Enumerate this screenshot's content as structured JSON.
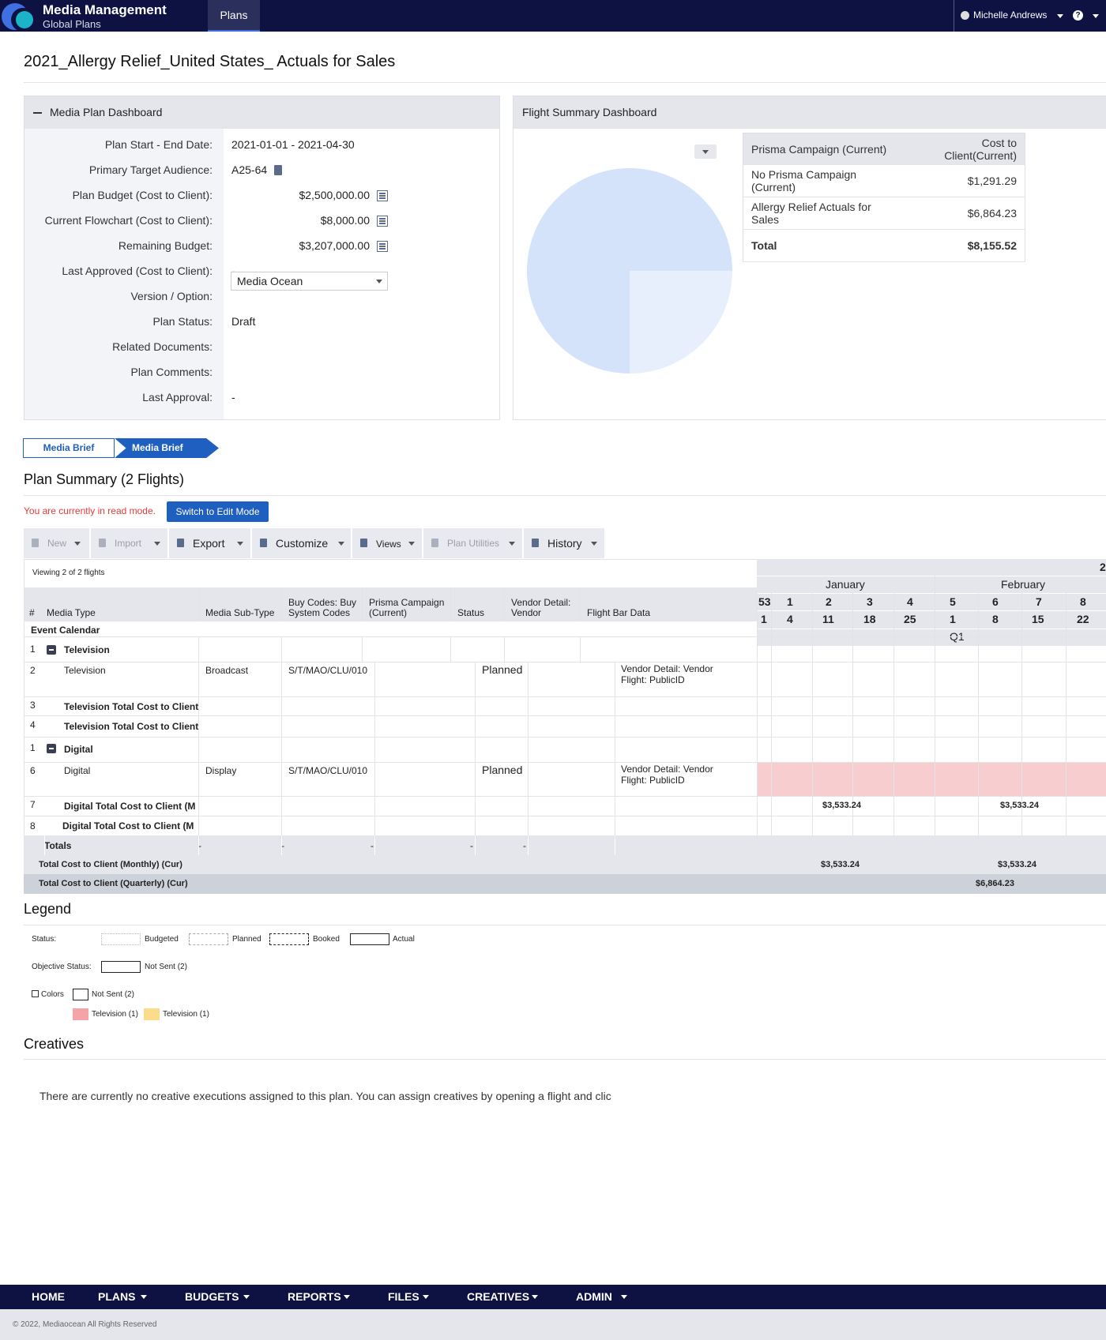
{
  "header": {
    "brand_title": "Media Management",
    "brand_subtitle": "Global Plans",
    "nav_active": "Plans",
    "user_name": "Michelle Andrews",
    "help_glyph": "?"
  },
  "page": {
    "title": "2021_Allergy Relief_United States_ Actuals for Sales"
  },
  "dashboard": {
    "title": "Media Plan Dashboard",
    "rows": [
      {
        "label": "Plan Start - End Date:",
        "value": "2021-01-01 - 2021-04-30"
      },
      {
        "label": "Primary Target Audience:",
        "value": "A25-64"
      },
      {
        "label": "Plan Budget (Cost to Client):",
        "value": "$2,500,000.00"
      },
      {
        "label": "Current Flowchart (Cost to Client):",
        "value": "$8,000.00"
      },
      {
        "label": "Remaining Budget:",
        "value": "$3,207,000.00"
      },
      {
        "label": "Last Approved (Cost to Client):",
        "value": "-"
      },
      {
        "label": "Version / Option:",
        "value": "Media Ocean"
      },
      {
        "label": "Plan Status:",
        "value": "Draft"
      },
      {
        "label": "Related Documents:",
        "value": ""
      },
      {
        "label": "Plan Comments:",
        "value": ""
      },
      {
        "label": "Last Approval:",
        "value": "-"
      }
    ]
  },
  "flight_summary": {
    "title": "Flight Summary Dashboard",
    "table": {
      "headers": [
        "Prisma Campaign (Current)",
        "Cost to Client(Current)"
      ],
      "rows": [
        {
          "name": "No Prisma Campaign (Current)",
          "value": "$1,291.29"
        },
        {
          "name": "Allergy Relief Actuals for Sales",
          "value": "$6,864.23"
        }
      ],
      "total_label": "Total",
      "total_value": "$8,155.52"
    },
    "pie": {
      "slices": [
        {
          "fraction": 0.75,
          "color": "#d4e2fa"
        },
        {
          "fraction": 0.25,
          "color": "#e8effc"
        }
      ]
    }
  },
  "steps": [
    "Media Brief",
    "Media Brief"
  ],
  "plan_summary": {
    "title": "Plan Summary (2 Flights)",
    "read_mode_text": "You are currently in read mode.",
    "edit_button": "Switch to Edit Mode",
    "toolbar": [
      {
        "label": "New",
        "enabled": false
      },
      {
        "label": "Import",
        "enabled": false
      },
      {
        "label": "Export",
        "enabled": true
      },
      {
        "label": "Customize",
        "enabled": true
      },
      {
        "label": "Views",
        "enabled": true
      },
      {
        "label": "Plan Utilities",
        "enabled": false
      },
      {
        "label": "History",
        "enabled": true
      }
    ],
    "viewing_text": "Viewing 2 of 2 flights",
    "columns": {
      "num": "#",
      "media_type": "Media Type",
      "media_sub_type": "Media Sub-Type",
      "buy_codes_1": "Buy Codes: Buy",
      "buy_codes_2": "System Codes",
      "prisma_1": "Prisma Campaign",
      "prisma_2": "(Current)",
      "status": "Status",
      "vendor_1": "Vendor Detail:",
      "vendor_2": "Vendor",
      "flight_bar": "Flight Bar Data"
    },
    "event_calendar": "Event Calendar",
    "calendar": {
      "year": "2",
      "months": [
        "January",
        "February"
      ],
      "weeks": [
        "53",
        "1",
        "2",
        "3",
        "4",
        "5",
        "6",
        "7",
        "8"
      ],
      "days": [
        "1",
        "4",
        "11",
        "18",
        "25",
        "1",
        "8",
        "15",
        "22"
      ],
      "quarter": "Q1"
    },
    "rows": [
      {
        "num": "1",
        "type": "Television",
        "group": true
      },
      {
        "num": "2",
        "type": "Television",
        "sub": "Broadcast",
        "codes": "S/T/MAO/CLU/010",
        "status": "Planned",
        "flight_1": "Vendor Detail: Vendor",
        "flight_2": "Flight: PublicID"
      },
      {
        "num": "3",
        "type": "Television Total Cost to Client"
      },
      {
        "num": "4",
        "type": "Television Total Cost to Client"
      },
      {
        "num": "1",
        "type": "Digital",
        "group": true
      },
      {
        "num": "6",
        "type": "Digital",
        "sub": "Display",
        "codes": "S/T/MAO/CLU/010",
        "status": "Planned",
        "flight_1": "Vendor Detail: Vendor",
        "flight_2": "Flight: PublicID"
      },
      {
        "num": "7",
        "type": "Digital Total Cost to Client (M",
        "jan": "$3,533.24",
        "feb": "$3,533.24"
      },
      {
        "num": "8",
        "type": "Digital Total Cost to Client (M"
      }
    ],
    "totals": {
      "label": "Totals",
      "dash": "-"
    },
    "total_monthly": {
      "label": "Total Cost to Client (Monthly) (Cur)",
      "jan": "$3,533.24",
      "feb": "$3,533.24"
    },
    "total_quarterly": {
      "label": "Total Cost to Client (Quarterly) (Cur)",
      "q1": "$6,864.23"
    }
  },
  "legend": {
    "title": "Legend",
    "status_label": "Status:",
    "statuses": [
      "Budgeted",
      "Planned",
      "Booked",
      "Actual"
    ],
    "objective_label": "Objective Status:",
    "objective_value": "Not Sent (2)",
    "colors_label": "Colors",
    "colors_not_sent": "Not Sent (2)",
    "color_items": [
      {
        "label": "Television (1)",
        "color": "#f5a3a8"
      },
      {
        "label": "Television (1)",
        "color": "#fbdc8a"
      }
    ]
  },
  "creatives": {
    "title": "Creatives",
    "message": "There are currently no creative executions assigned to this plan. You can assign creatives by opening a flight and clic"
  },
  "footer": {
    "nav": [
      "HOME",
      "PLANS",
      "BUDGETS",
      "REPORTS",
      "FILES",
      "CREATIVES",
      "ADMIN"
    ],
    "copyright": "© 2022, Mediaocean All Rights Reserved"
  }
}
